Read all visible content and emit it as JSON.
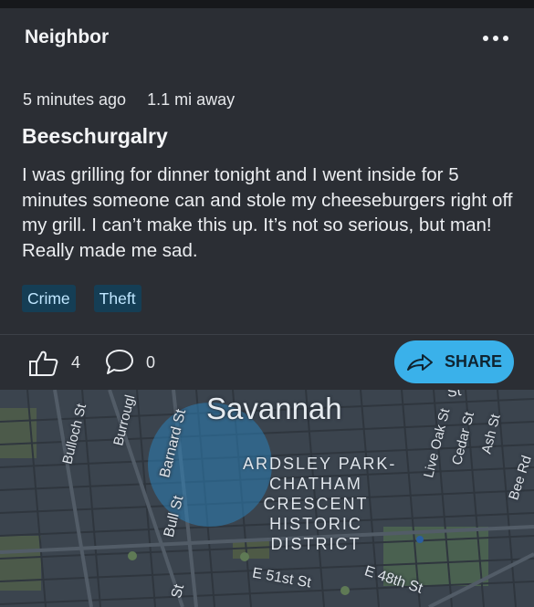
{
  "header": {
    "title": "Neighbor",
    "more_icon": "more-horizontal-icon"
  },
  "post": {
    "time_ago": "5 minutes ago",
    "distance": "1.1 mi away",
    "title": "Beeschurgalry",
    "body": "I was grilling for dinner tonight and I went inside for 5 minutes someone can and stole my cheeseburgers right off my grill. I can’t make this up. It’s not so serious, but man! Really made me sad.",
    "tags": [
      "Crime",
      "Theft"
    ]
  },
  "actions": {
    "like_count": "4",
    "comment_count": "0",
    "share_label": "SHARE",
    "colors": {
      "share_bg": "#3ab1ea",
      "tag_bg": "#153e55"
    }
  },
  "map": {
    "city_label": "Savannah",
    "district_lines": [
      "ARDSLEY PARK-",
      "CHATHAM",
      "CRESCENT",
      "HISTORIC",
      "DISTRICT"
    ],
    "street_labels": {
      "bulloch": "Bulloch St",
      "burroughs": "Burrougl",
      "barnard": "Barnard St",
      "bull": "Bull St",
      "live_oak": "Live Oak St",
      "cedar": "Cedar St",
      "ash": "Ash St",
      "bee": "Bee Rd",
      "e51": "E 51st St",
      "e48": "E 48th St",
      "top_st": "St",
      "bottom_st": "St"
    }
  }
}
